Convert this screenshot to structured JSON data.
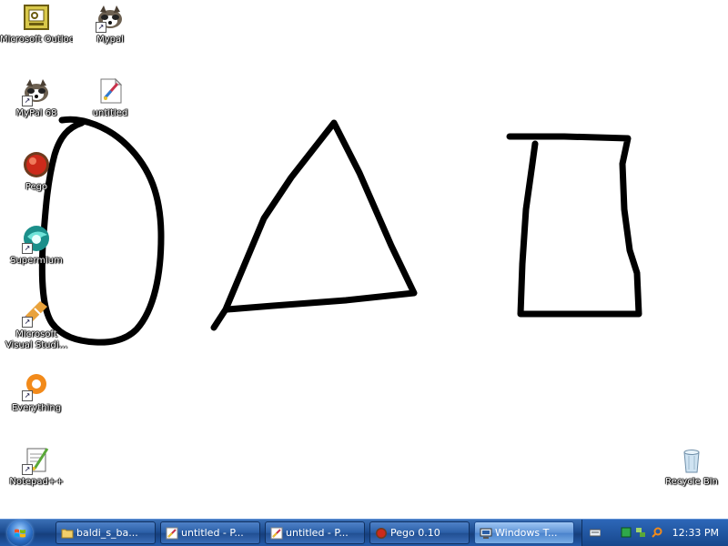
{
  "desktop": {
    "icons": [
      {
        "label": "Microsoft Outlook",
        "icon": "outlook-icon",
        "shortcut": false
      },
      {
        "label": "Mypal",
        "icon": "mypal-icon",
        "shortcut": true
      },
      {
        "label": "MyPal 68",
        "icon": "mypal-icon",
        "shortcut": true
      },
      {
        "label": "untitled",
        "icon": "paint-icon",
        "shortcut": false
      },
      {
        "label": "Pego",
        "icon": "pego-icon",
        "shortcut": false
      },
      {
        "label": "Supermium",
        "icon": "supermium-icon",
        "shortcut": true
      },
      {
        "label": "Microsoft Visual Studi...",
        "icon": "visual-studio-icon",
        "shortcut": true
      },
      {
        "label": "Everything",
        "icon": "everything-icon",
        "shortcut": true
      },
      {
        "label": "Notepad++",
        "icon": "notepad-plus-icon",
        "shortcut": true
      },
      {
        "label": "Recycle Bin",
        "icon": "recycle-bin-icon",
        "shortcut": false
      }
    ],
    "drawing": {
      "stroke_color": "#000000",
      "shapes": [
        "oval",
        "triangle",
        "cup"
      ]
    }
  },
  "taskbar": {
    "buttons": [
      {
        "label": "baldi_s_ba...",
        "icon": "folder-icon"
      },
      {
        "label": "untitled - P...",
        "icon": "paint-icon"
      },
      {
        "label": "untitled - P...",
        "icon": "paint-icon"
      },
      {
        "label": "Pego 0.10",
        "icon": "pego-icon"
      },
      {
        "label": "Windows T...",
        "icon": "task-manager-icon",
        "active": true
      }
    ],
    "clock": "12:33 PM"
  },
  "colors": {
    "taskbar": "#1c4b8f",
    "desktop_background": "#ffffff"
  }
}
